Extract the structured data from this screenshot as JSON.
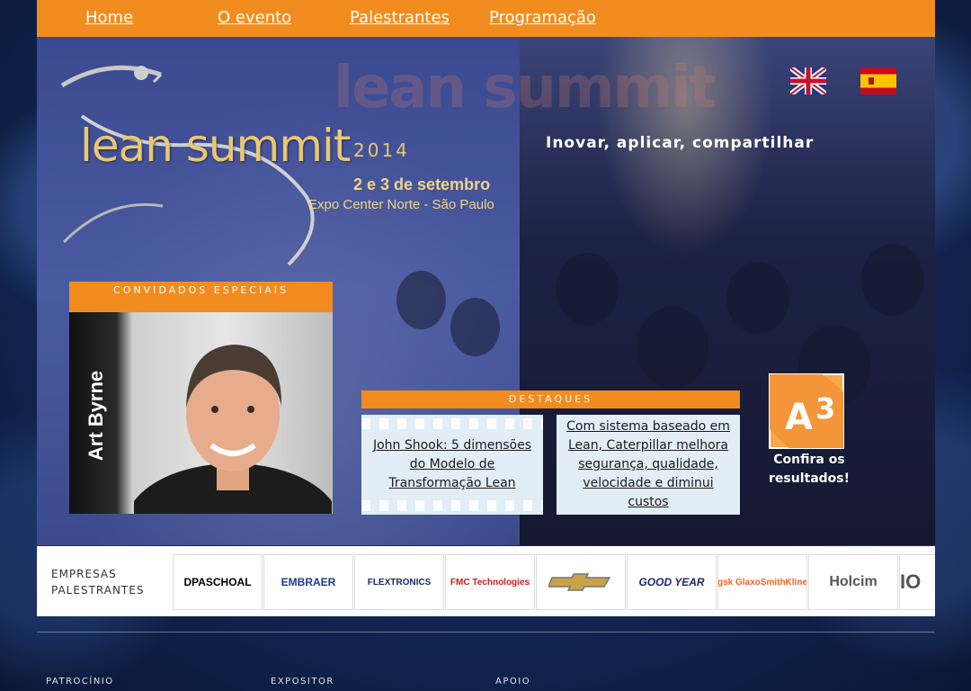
{
  "nav": {
    "items": [
      "Home",
      "O evento",
      "Palestrantes",
      "Programação"
    ]
  },
  "hero": {
    "background_text": "lean summit",
    "logo_text": "lean summit",
    "logo_year": "2014",
    "date": "2 e 3 de setembro",
    "venue": "Expo Center Norte - São Paulo",
    "tagline": "Inovar, aplicar, compartilhar",
    "flags": [
      "uk-flag-icon",
      "spain-flag-icon"
    ]
  },
  "guests": {
    "header": "CONVIDADOS ESPECIAIS",
    "name": "Art Byrne"
  },
  "highlights": {
    "header": "DESTAQUES",
    "items": [
      "John Shook: 5 dimensões do Modelo de Transformação Lean",
      "Com sistema baseado em Lean, Caterpillar melhora segurança, qualidade, velocidade e diminui custos"
    ]
  },
  "a3": {
    "icon": "a3-icon",
    "label": "Confira os resultados!"
  },
  "sponsors": {
    "label": "EMPRESAS PALESTRANTES",
    "logos": [
      "DPASCHOAL",
      "EMBRAER",
      "FLEXTRONICS",
      "FMC Technologies",
      "Chevrolet",
      "GOOD YEAR",
      "gsk GlaxoSmithKline",
      "Holcim",
      "IO"
    ]
  },
  "footer": {
    "labels": [
      "PATROCÍNIO",
      "EXPOSITOR",
      "APOIO"
    ]
  },
  "colors": {
    "accent": "#f28c1e",
    "hero_blue": "#3e4f94",
    "gold": "#e9c874"
  }
}
